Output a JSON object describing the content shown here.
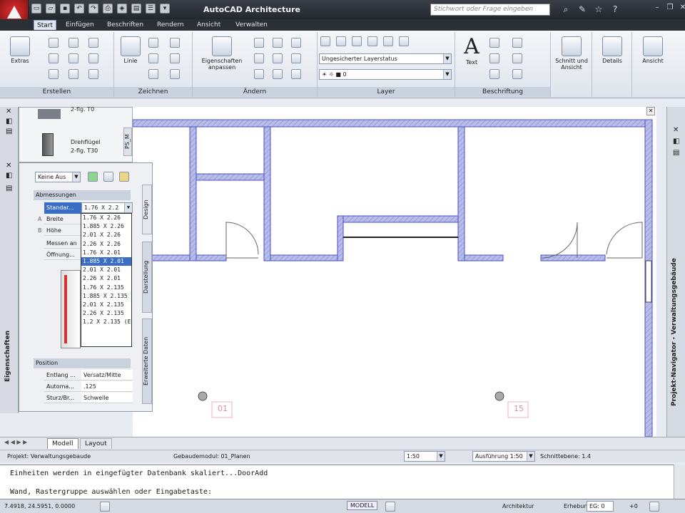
{
  "titlebar": {
    "app_title": "AutoCAD Architecture",
    "search_placeholder": "Stichwort oder Frage eingeben"
  },
  "tabs": [
    "Start",
    "Einfügen",
    "Beschriften",
    "Rendern",
    "Ansicht",
    "Verwalten"
  ],
  "ribbon": {
    "panels": {
      "erstellen": "Erstellen",
      "zeichnen": "Zeichnen",
      "aendern": "Ändern",
      "layer": "Layer",
      "beschriftung": "Beschriftung"
    },
    "extras": "Extras",
    "linie": "Linie",
    "eigenschaften_1": "Eigenschaften",
    "eigenschaften_2": "anpassen",
    "layerstatus": "Ungesicherter Layerstatus",
    "layer_value": "0",
    "text": "Text",
    "schnitt_1": "Schnitt und",
    "schnitt_2": "Ansicht",
    "details": "Details",
    "ansicht": "Ansicht"
  },
  "toolpalette": {
    "tool_top": "2-flg. T0",
    "tool_label_1": "Drehflügel",
    "tool_label_2": "2-flg. T30",
    "side_tab": "PS_M"
  },
  "properties": {
    "title": "Eigenschaften",
    "style_combo": "Keine Aus",
    "section_dimensions": "Abmessungen",
    "standard_label": "Standar...",
    "standard_value": "1.76 X 2.2",
    "rows": [
      "Breite",
      "Höhe",
      "Messen an",
      "Öffnung..."
    ],
    "row_letters": [
      "A",
      "B"
    ],
    "dropdown_items": [
      "1.76 X 2.26",
      "1.885 X 2.26",
      "2.01 X 2.26",
      "2.26 X 2.26",
      "1.76 X 2.01",
      "1.885 X 2.01",
      "2.01 X 2.01",
      "2.26 X 2.01",
      "1.76 X 2.135",
      "1.885 X 2.135",
      "2.01 X 2.135",
      "2.26 X 2.135",
      "1.2 X 2.135 (E"
    ],
    "selected_index": 5,
    "section_position": "Position",
    "position_rows": [
      {
        "label": "Entlang ...",
        "value": "Versatz/Mitte"
      },
      {
        "label": "Automa...",
        "value": ".125"
      },
      {
        "label": "Sturz/Br...",
        "value": "Schwelle"
      }
    ],
    "side_tabs": [
      "Design",
      "Darstellung",
      "Erweiterte Daten"
    ]
  },
  "drawing": {
    "grid_labels": [
      "01",
      "15"
    ]
  },
  "navigator": {
    "title": "Projekt-Navigator - Verwaltungsgebäude"
  },
  "layout_tabs": [
    "Modell",
    "Layout"
  ],
  "status": {
    "project": "Projekt: Verwaltungsgebaude",
    "module": "Gebaudemodul: 01_Planen",
    "scale": "1:50",
    "detail": "Ausführung 1:50",
    "cut_plane": "Schnittebene: 1.4"
  },
  "command": {
    "line1": "Einheiten werden in eingefügter Datenbank skaliert...DoorAdd",
    "line2": "Wand, Rastergruppe auswählen oder Eingabetaste:"
  },
  "bottombar": {
    "coords": "7.4918, 24.5951, 0.0000",
    "modell": "MODELL",
    "workspace": "Architektur",
    "elevation": "Erhebung",
    "level": "EG: 0",
    "offset": "+0"
  },
  "colors": {
    "wall_fill": "#b8bde6",
    "wall_edge": "#4a4fd0",
    "selection": "#3a6ec4",
    "ribbon_bg": "#e2e7ee",
    "titlebar_bg": "#2b2f36"
  }
}
